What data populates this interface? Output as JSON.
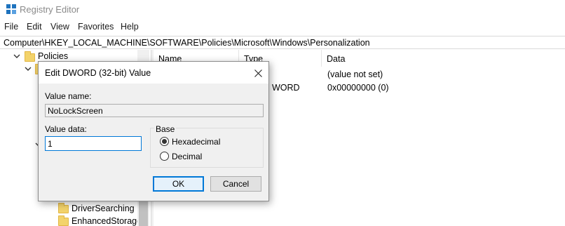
{
  "window": {
    "title": "Registry Editor"
  },
  "menu": [
    "File",
    "Edit",
    "View",
    "Favorites",
    "Help"
  ],
  "address": "Computer\\HKEY_LOCAL_MACHINE\\SOFTWARE\\Policies\\Microsoft\\Windows\\Personalization",
  "tree": {
    "items": [
      {
        "label": "Policies",
        "icon": "folder-icon",
        "expander": "expanded"
      },
      {
        "label": "",
        "icon": "folder-icon",
        "expander": "expanded"
      },
      {
        "label": "DriverSearching",
        "icon": "folder-icon"
      },
      {
        "label": "EnhancedStorageI",
        "icon": "folder-icon"
      }
    ]
  },
  "list": {
    "columns": [
      "Name",
      "Type",
      "Data"
    ],
    "rows": [
      {
        "type": "",
        "data": "(value not set)"
      },
      {
        "type": "WORD",
        "data": "0x00000000 (0)"
      }
    ]
  },
  "dialog": {
    "title": "Edit DWORD (32-bit) Value",
    "value_name_label": "Value name:",
    "value_name": "NoLockScreen",
    "value_data_label": "Value data:",
    "value_data": "1",
    "base_label": "Base",
    "radios": [
      {
        "label": "Hexadecimal",
        "checked": true
      },
      {
        "label": "Decimal",
        "checked": false
      }
    ],
    "ok_label": "OK",
    "cancel_label": "Cancel"
  }
}
